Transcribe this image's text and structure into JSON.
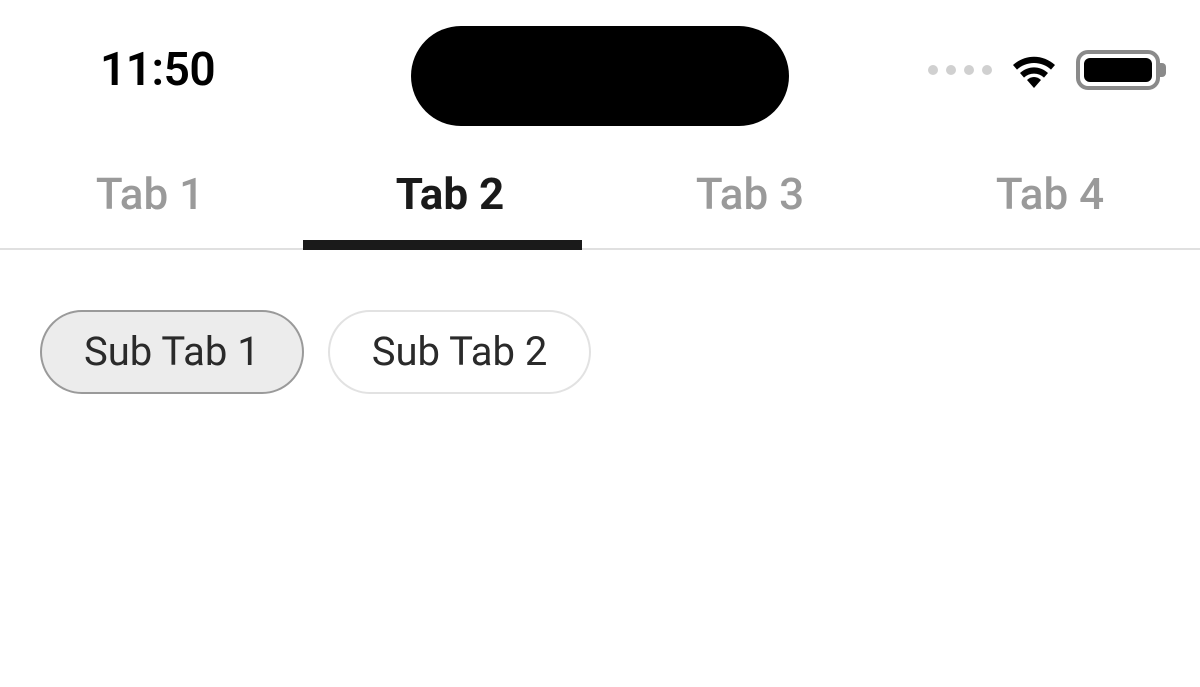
{
  "statusBar": {
    "time": "11:50"
  },
  "tabs": [
    {
      "label": "Tab 1",
      "active": false
    },
    {
      "label": "Tab 2",
      "active": true
    },
    {
      "label": "Tab 3",
      "active": false
    },
    {
      "label": "Tab 4",
      "active": false
    }
  ],
  "subTabs": [
    {
      "label": "Sub Tab 1",
      "selected": true
    },
    {
      "label": "Sub Tab 2",
      "selected": false
    }
  ]
}
